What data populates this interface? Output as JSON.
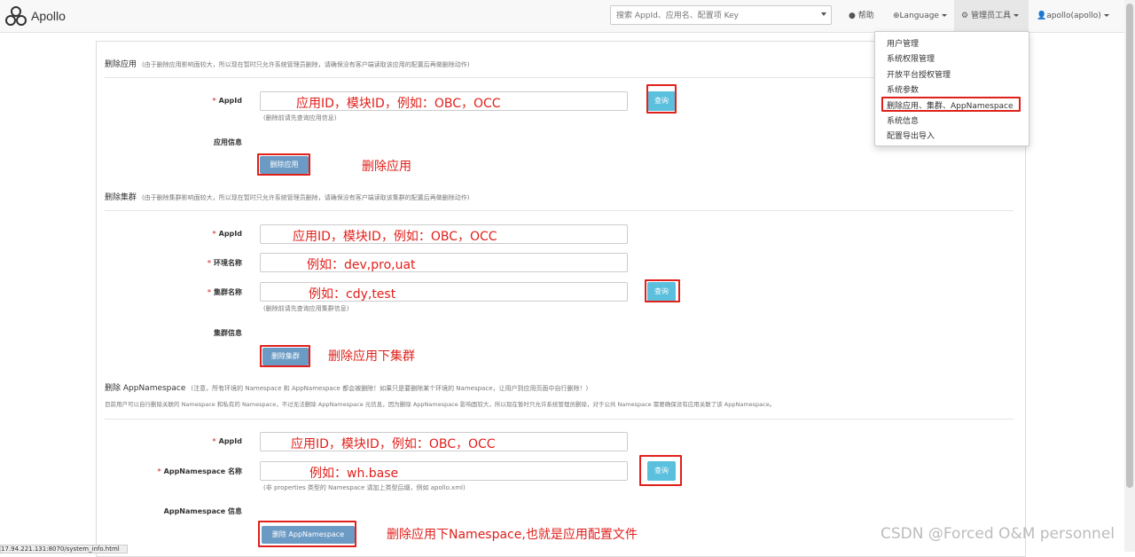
{
  "navbar": {
    "brand": "Apollo",
    "search_placeholder": "搜索 AppId、应用名、配置项 Key",
    "help": "帮助",
    "language": "Language",
    "admin_tools": "管理员工具",
    "user": "apollo(apollo)"
  },
  "admin_menu": {
    "items": [
      "用户管理",
      "系统权限管理",
      "开放平台授权管理",
      "系统参数",
      "删除应用、集群、AppNamespace",
      "系统信息",
      "配置导出导入"
    ]
  },
  "delete_app": {
    "title": "删除应用",
    "note": "(由于删除应用影响面较大，所以现在暂时只允许系统管理员删除，请确保没有客户端读取该应用的配置后再做删除动作)",
    "appid_label": "AppId",
    "appid_value": "应用ID，模块ID，例如：OBC，OCC",
    "query_button": "查询",
    "hint": "(删除前请先查询应用信息)",
    "info_label": "应用信息",
    "delete_button": "删除应用",
    "annotation": "删除应用"
  },
  "delete_cluster": {
    "title": "删除集群",
    "note": "(由于删除集群影响面较大，所以现在暂时只允许系统管理员删除，请确保没有客户端读取该集群的配置后再做删除动作)",
    "appid_label": "AppId",
    "appid_value": "应用ID，模块ID，例如：OBC，OCC",
    "env_label": "环境名称",
    "env_value": "例如：dev,pro,uat",
    "cluster_label": "集群名称",
    "cluster_value": "例如：cdy,test",
    "query_button": "查询",
    "hint": "(删除前请先查询应用集群信息)",
    "info_label": "集群信息",
    "delete_button": "删除集群",
    "annotation": "删除应用下集群"
  },
  "delete_namespace": {
    "title": "删除 AppNamespace",
    "note": "(注意，所有环境的 Namespace 和 AppNamespace 都会被删除！如果只是要删除某个环境的 Namespace，让用户到应用页面中自行删除！)",
    "desc": "目前用户可以自行删除关联的 Namespace 和私有的 Namespace，不过无法删除 AppNamespace 元信息，因为删除 AppNamespace 影响面较大，所以现在暂时只允许系统管理员删除，对于公共 Namespace 需要确保没有应用关联了该 AppNamespace。",
    "appid_label": "AppId",
    "appid_value": "应用ID，模块ID，例如：OBC，OCC",
    "ns_label": "AppNamespace 名称",
    "ns_value": "例如：wh.base",
    "query_button": "查询",
    "hint": "(非 properties 类型的 Namespace 请加上类型后缀，例如 apollo.xml)",
    "info_label": "AppNamespace 信息",
    "delete_button": "删除 AppNamespace",
    "annotation": "删除应用下Namespace,也就是应用配置文件"
  },
  "status_url": "17.94.221.131:8070/system_info.html",
  "watermark": "CSDN @Forced O&M personnel",
  "colors": {
    "annotation_red": "#e0201b",
    "query_button": "#5bc0de",
    "delete_button": "#6b9ac4",
    "required_star": "#d9534f"
  }
}
